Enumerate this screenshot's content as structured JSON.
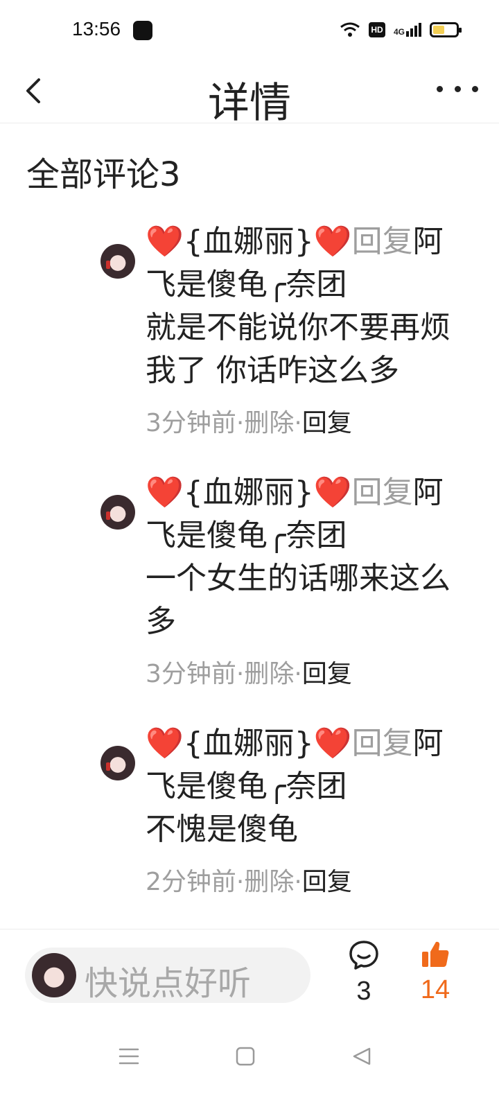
{
  "status": {
    "time": "13:56",
    "hd": "HD",
    "network": "4G"
  },
  "nav": {
    "title": "详情"
  },
  "comments_header": "全部评论3",
  "comments": [
    {
      "heart_left": "❤️",
      "author": "{血娜丽}",
      "heart_right": "❤️",
      "reply_word": "回复",
      "target": "阿飞是傻龟╭奈团",
      "text": "就是不能说你不要再烦我了 你话咋这么多",
      "time": "3分钟前",
      "delete_label": "删除",
      "reply_label": "回复"
    },
    {
      "heart_left": "❤️",
      "author": "{血娜丽}",
      "heart_right": "❤️",
      "reply_word": "回复",
      "target": "阿飞是傻龟╭奈团",
      "text": "一个女生的话哪来这么多",
      "time": "3分钟前",
      "delete_label": "删除",
      "reply_label": "回复"
    },
    {
      "heart_left": "❤️",
      "author": "{血娜丽}",
      "heart_right": "❤️",
      "reply_word": "回复",
      "target": "阿飞是傻龟╭奈团",
      "text": "不愧是傻龟",
      "time": "2分钟前",
      "delete_label": "删除",
      "reply_label": "回复"
    }
  ],
  "bottom": {
    "placeholder": "快说点好听",
    "comment_count": "3",
    "like_count": "14"
  },
  "colors": {
    "accent_like": "#f06a1b",
    "heart": "#e53935",
    "muted": "#9e9e9e"
  },
  "icons": {
    "back": "chevron-left-icon",
    "more": "more-dots-icon",
    "comment": "comment-bubble-icon",
    "like": "thumbs-up-icon",
    "menu": "menu-icon",
    "home": "home-square-icon",
    "system_back": "triangle-back-icon"
  }
}
